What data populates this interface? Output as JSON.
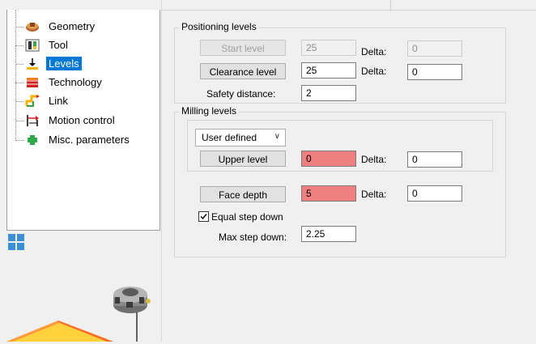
{
  "tree": {
    "items": [
      {
        "label": "Geometry",
        "icon": "geometry-icon",
        "selected": false
      },
      {
        "label": "Tool",
        "icon": "tool-icon",
        "selected": false
      },
      {
        "label": "Levels",
        "icon": "levels-icon",
        "selected": true
      },
      {
        "label": "Technology",
        "icon": "technology-icon",
        "selected": false
      },
      {
        "label": "Link",
        "icon": "link-icon",
        "selected": false
      },
      {
        "label": "Motion control",
        "icon": "motion-control-icon",
        "selected": false
      },
      {
        "label": "Misc. parameters",
        "icon": "misc-parameters-icon",
        "selected": false
      }
    ]
  },
  "positioning": {
    "title": "Positioning levels",
    "start_level_label": "Start level",
    "start_level_value": "25",
    "start_delta_label": "Delta:",
    "start_delta_value": "0",
    "clearance_label": "Clearance level",
    "clearance_value": "25",
    "clearance_delta_label": "Delta:",
    "clearance_delta_value": "0",
    "safety_label": "Safety distance:",
    "safety_value": "2"
  },
  "milling": {
    "title": "Milling levels",
    "mode_selected": "User defined",
    "upper_label": "Upper level",
    "upper_value": "0",
    "upper_delta_label": "Delta:",
    "upper_delta_value": "0",
    "face_label": "Face depth",
    "face_value": "5",
    "face_delta_label": "Delta:",
    "face_delta_value": "0",
    "equal_step_label": "Equal step down",
    "equal_step_checked": true,
    "max_step_label": "Max step down:",
    "max_step_value": "2.25"
  },
  "colors": {
    "selection": "#0078d7",
    "invalid_field": "#f08080",
    "stock_orange": "#ff9a3c",
    "stock_yellow": "#ffd23c"
  }
}
